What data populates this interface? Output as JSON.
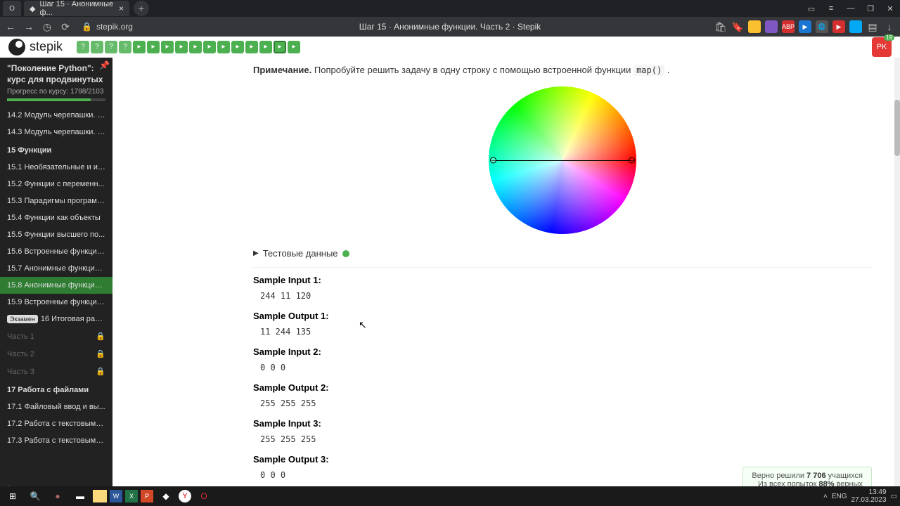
{
  "browser": {
    "tab_title": "Шаг 15 · Анонимные ф...",
    "url_host": "stepik.org",
    "page_title": "Шаг 15 · Анонимные функции. Часть 2 · Stepik"
  },
  "header": {
    "logo_text": "stepik",
    "user_initials": "PK",
    "notif": "19"
  },
  "sidebar": {
    "course_title": "\"Поколение Python\": курс для продвинутых",
    "progress_label": "Прогресс по курсу:  1798/2103",
    "items": [
      {
        "label": "14.2  Модуль черепашки. Ч...",
        "type": "item"
      },
      {
        "label": "14.3  Модуль черепашки. Ч...",
        "type": "item"
      },
      {
        "label": "15  Функции",
        "type": "section"
      },
      {
        "label": "15.1  Необязательные и им...",
        "type": "item"
      },
      {
        "label": "15.2  Функции с переменн...",
        "type": "item"
      },
      {
        "label": "15.3  Парадигмы программ...",
        "type": "item"
      },
      {
        "label": "15.4  Функции как объекты",
        "type": "item"
      },
      {
        "label": "15.5  Функции высшего по...",
        "type": "item"
      },
      {
        "label": "15.6  Встроенные функции ...",
        "type": "item"
      },
      {
        "label": "15.7  Анонимные функции. ...",
        "type": "item"
      },
      {
        "label": "15.8  Анонимные функции. ...",
        "type": "item",
        "active": true
      },
      {
        "label": "15.9  Встроенные функции ...",
        "type": "item"
      },
      {
        "label": "16  Итоговая работ...",
        "type": "exam",
        "badge": "Экзамен"
      },
      {
        "label": "Часть 1",
        "type": "locked"
      },
      {
        "label": "Часть 2",
        "type": "locked"
      },
      {
        "label": "Часть 3",
        "type": "locked"
      },
      {
        "label": "17  Работа с файлами",
        "type": "section"
      },
      {
        "label": "17.1  Файловый ввод и вы...",
        "type": "item"
      },
      {
        "label": "17.2  Работа с текстовыми ...",
        "type": "item"
      },
      {
        "label": "17.3  Работа с текстовыми ...",
        "type": "item"
      }
    ]
  },
  "content": {
    "note_bold": "Примечание.",
    "note_text": " Попробуйте решить задачу в одну строку с помощью встроенной функции ",
    "note_code": "map()",
    "test_toggle": "Тестовые данные",
    "samples": [
      {
        "h": "Sample Input 1:",
        "v": "244 11 120"
      },
      {
        "h": "Sample Output 1:",
        "v": "11 244 135"
      },
      {
        "h": "Sample Input 2:",
        "v": "0 0 0"
      },
      {
        "h": "Sample Output 2:",
        "v": "255 255 255"
      },
      {
        "h": "Sample Input 3:",
        "v": "255 255 255"
      },
      {
        "h": "Sample Output 3:",
        "v": "0 0 0"
      }
    ],
    "stats_line1_a": "Верно решили ",
    "stats_line1_b": "7 706",
    "stats_line1_c": " учащихся",
    "stats_line2_a": "Из всех попыток ",
    "stats_line2_b": "88%",
    "stats_line2_c": " верных"
  },
  "taskbar": {
    "lang": "ENG",
    "time": "13:49",
    "date": "27.03.2023"
  }
}
